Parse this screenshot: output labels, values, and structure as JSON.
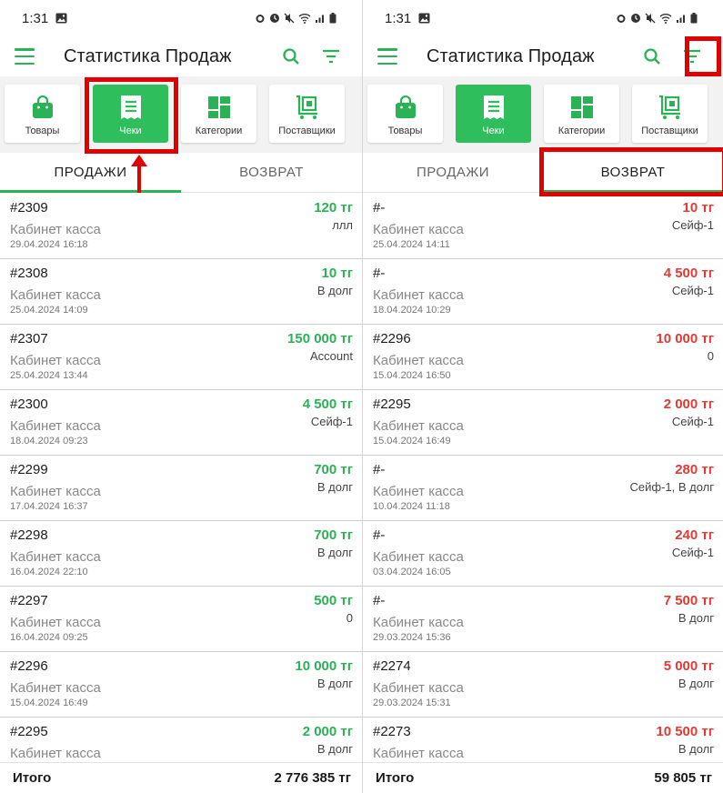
{
  "colors": {
    "green": "#2bb256",
    "card_active": "#2fbe5c",
    "sale_amount": "#2bb256",
    "return_amount": "#e53935",
    "annotation": "#e00000"
  },
  "left": {
    "status": {
      "time": "1:31"
    },
    "appbar": {
      "title": "Статистика Продаж"
    },
    "cards": [
      {
        "label": "Товары",
        "icon": "shopping-bag-icon"
      },
      {
        "label": "Чеки",
        "icon": "receipt-icon",
        "active": true
      },
      {
        "label": "Категории",
        "icon": "category-grid-icon"
      },
      {
        "label": "Поставщики",
        "icon": "supplier-cart-icon"
      }
    ],
    "tabs": [
      "ПРОДАЖИ",
      "ВОЗВРАТ"
    ],
    "active_tab": 0,
    "rows": [
      {
        "num": "#2309",
        "place": "Кабинет касса",
        "date": "29.04.2024 16:18",
        "amount": "120 тг",
        "note": "ллл"
      },
      {
        "num": "#2308",
        "place": "Кабинет касса",
        "date": "25.04.2024 14:09",
        "amount": "10 тг",
        "note": "В долг"
      },
      {
        "num": "#2307",
        "place": "Кабинет касса",
        "date": "25.04.2024 13:44",
        "amount": "150 000 тг",
        "note": "Account"
      },
      {
        "num": "#2300",
        "place": "Кабинет касса",
        "date": "18.04.2024 09:23",
        "amount": "4 500 тг",
        "note": "Сейф-1"
      },
      {
        "num": "#2299",
        "place": "Кабинет касса",
        "date": "17.04.2024 16:37",
        "amount": "700 тг",
        "note": "В долг"
      },
      {
        "num": "#2298",
        "place": "Кабинет касса",
        "date": "16.04.2024 22:10",
        "amount": "700 тг",
        "note": "В долг"
      },
      {
        "num": "#2297",
        "place": "Кабинет касса",
        "date": "16.04.2024 09:25",
        "amount": "500 тг",
        "note": "0"
      },
      {
        "num": "#2296",
        "place": "Кабинет касса",
        "date": "15.04.2024 16:49",
        "amount": "10 000 тг",
        "note": "В долг"
      },
      {
        "num": "#2295",
        "place": "Кабинет касса",
        "date": "",
        "amount": "2 000 тг",
        "note": "В долг"
      }
    ],
    "footer": {
      "label": "Итого",
      "total": "2 776 385 тг"
    }
  },
  "right": {
    "status": {
      "time": "1:31"
    },
    "appbar": {
      "title": "Статистика Продаж"
    },
    "cards": [
      {
        "label": "Товары",
        "icon": "shopping-bag-icon"
      },
      {
        "label": "Чеки",
        "icon": "receipt-icon",
        "active": true
      },
      {
        "label": "Категории",
        "icon": "category-grid-icon"
      },
      {
        "label": "Поставщики",
        "icon": "supplier-cart-icon"
      }
    ],
    "tabs": [
      "ПРОДАЖИ",
      "ВОЗВРАТ"
    ],
    "active_tab": 1,
    "rows": [
      {
        "num": "#-",
        "place": "Кабинет касса",
        "date": "25.04.2024 14:11",
        "amount": "10 тг",
        "note": "Сейф-1"
      },
      {
        "num": "#-",
        "place": "Кабинет касса",
        "date": "18.04.2024 10:29",
        "amount": "4 500 тг",
        "note": "Сейф-1"
      },
      {
        "num": "#2296",
        "place": "Кабинет касса",
        "date": "15.04.2024 16:50",
        "amount": "10 000 тг",
        "note": "0"
      },
      {
        "num": "#2295",
        "place": "Кабинет касса",
        "date": "15.04.2024 16:49",
        "amount": "2 000 тг",
        "note": "Сейф-1"
      },
      {
        "num": "#-",
        "place": "Кабинет касса",
        "date": "10.04.2024 11:18",
        "amount": "280 тг",
        "note": "Сейф-1, В долг"
      },
      {
        "num": "#-",
        "place": "Кабинет касса",
        "date": "03.04.2024 16:05",
        "amount": "240 тг",
        "note": "Сейф-1"
      },
      {
        "num": "#-",
        "place": "Кабинет касса",
        "date": "29.03.2024 15:36",
        "amount": "7 500 тг",
        "note": "В долг"
      },
      {
        "num": "#2274",
        "place": "Кабинет касса",
        "date": "29.03.2024 15:31",
        "amount": "5 000 тг",
        "note": "В долг"
      },
      {
        "num": "#2273",
        "place": "Кабинет касса",
        "date": "",
        "amount": "10 500 тг",
        "note": "В долг"
      }
    ],
    "footer": {
      "label": "Итого",
      "total": "59 805 тг"
    }
  }
}
